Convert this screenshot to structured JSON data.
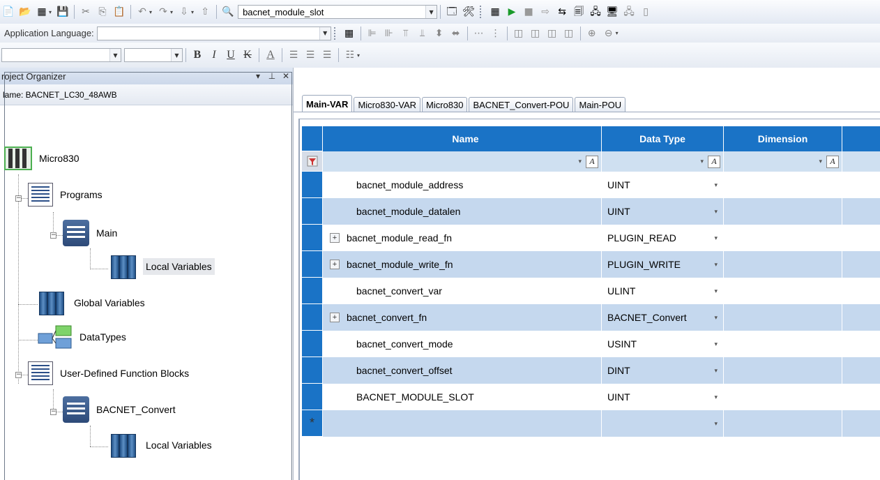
{
  "toolbar1": {
    "project_combo": "bacnet_module_slot"
  },
  "toolbar2": {
    "language_label": "Application Language:",
    "language_value": ""
  },
  "toolbar3": {
    "font_value": "",
    "size_value": "",
    "bold": "B",
    "italic": "I",
    "underline": "U",
    "strike": "K"
  },
  "organizer": {
    "title": "roject Organizer",
    "pin": "↓ ↑",
    "close": "✕",
    "name_line": "lame: BACNET_LC30_48AWB",
    "tree": {
      "micro": "Micro830",
      "programs": "Programs",
      "main": "Main",
      "main_locals": "Local Variables",
      "globals": "Global Variables",
      "datatypes": "DataTypes",
      "udfb": "User-Defined Function Blocks",
      "bacnet_convert": "BACNET_Convert",
      "bacnet_locals": "Local Variables"
    }
  },
  "tabs": [
    "Main-VAR",
    "Micro830-VAR",
    "Micro830",
    "BACNET_Convert-POU",
    "Main-POU"
  ],
  "grid": {
    "columns": [
      "Name",
      "Data Type",
      "Dimension"
    ],
    "rows": [
      {
        "name": "bacnet_module_address",
        "type": "UINT",
        "expandable": false
      },
      {
        "name": "bacnet_module_datalen",
        "type": "UINT",
        "expandable": false
      },
      {
        "name": "bacnet_module_read_fn",
        "type": "PLUGIN_READ",
        "expandable": true
      },
      {
        "name": "bacnet_module_write_fn",
        "type": "PLUGIN_WRITE",
        "expandable": true
      },
      {
        "name": "bacnet_convert_var",
        "type": "ULINT",
        "expandable": false
      },
      {
        "name": "bacnet_convert_fn",
        "type": "BACNET_Convert",
        "expandable": true
      },
      {
        "name": "bacnet_convert_mode",
        "type": "USINT",
        "expandable": false
      },
      {
        "name": "bacnet_convert_offset",
        "type": "DINT",
        "expandable": false
      },
      {
        "name": "BACNET_MODULE_SLOT",
        "type": "UINT",
        "expandable": false
      }
    ],
    "new_row_marker": "*"
  },
  "colors": {
    "grid_header": "#1a73c6",
    "row_alt": "#c5d8ee"
  }
}
